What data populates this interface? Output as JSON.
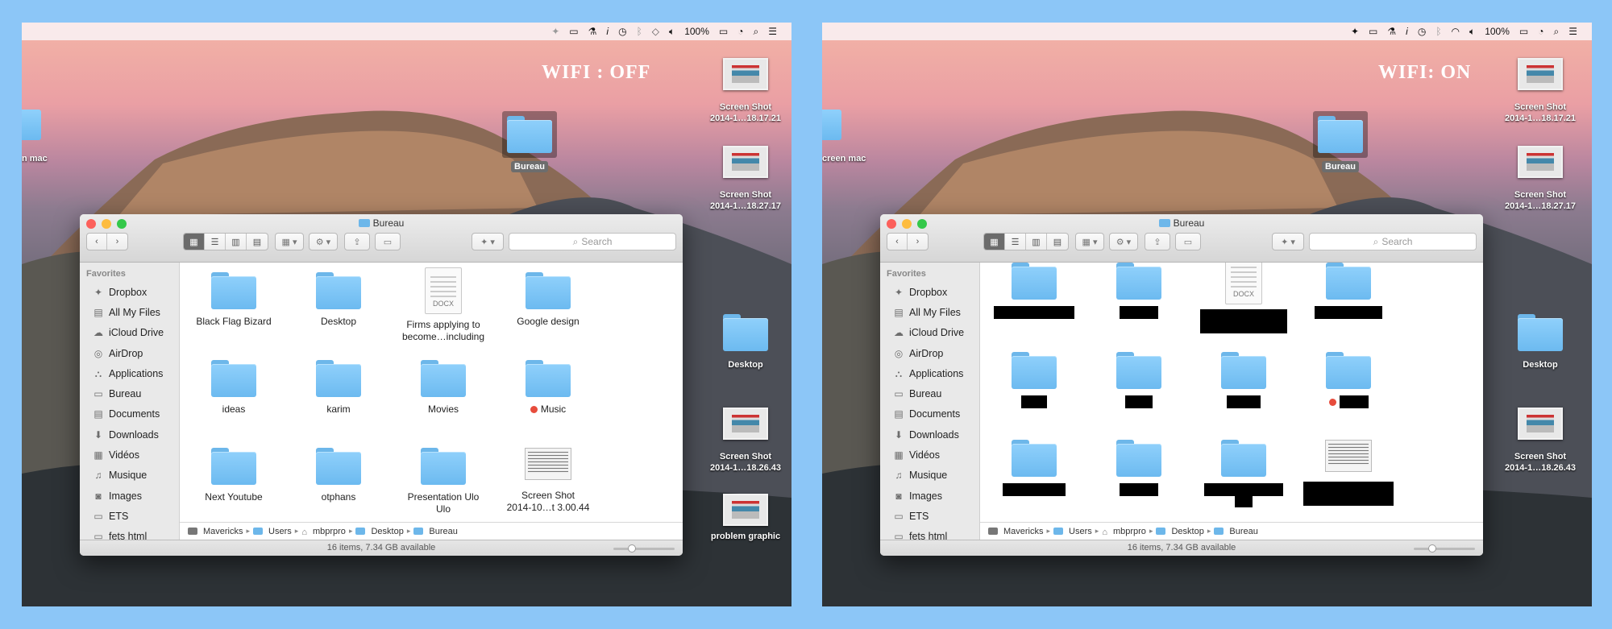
{
  "menubar": {
    "battery": "100%"
  },
  "left": {
    "caption": "WIFI : OFF",
    "edge_label": "n mac",
    "desktop": {
      "bureau": "Bureau",
      "shot1": [
        "Screen Shot",
        "2014-1…18.17.21"
      ],
      "shot2": [
        "Screen Shot",
        "2014-1…18.27.17"
      ],
      "desktop_folder": "Desktop",
      "shot3": [
        "Screen Shot",
        "2014-1…18.26.43"
      ],
      "problem": "problem graphic"
    }
  },
  "right": {
    "caption": "WIFI: ON",
    "edge_label": "creen mac",
    "desktop": {
      "bureau": "Bureau",
      "shot1": [
        "Screen Shot",
        "2014-1…18.17.21"
      ],
      "shot2": [
        "Screen Shot",
        "2014-1…18.27.17"
      ],
      "desktop_folder": "Desktop",
      "shot3": [
        "Screen Shot",
        "2014-1…18.26.43"
      ]
    }
  },
  "finder": {
    "title": "Bureau",
    "search_placeholder": "Search",
    "sidebar_heading": "Favorites",
    "sidebar_items": [
      {
        "label": "Dropbox",
        "icon": "dropbox-icon"
      },
      {
        "label": "All My Files",
        "icon": "all-files-icon"
      },
      {
        "label": "iCloud Drive",
        "icon": "cloud-icon"
      },
      {
        "label": "AirDrop",
        "icon": "airdrop-icon"
      },
      {
        "label": "Applications",
        "icon": "applications-icon"
      },
      {
        "label": "Bureau",
        "icon": "folder-icon"
      },
      {
        "label": "Documents",
        "icon": "documents-icon"
      },
      {
        "label": "Downloads",
        "icon": "downloads-icon"
      },
      {
        "label": "Vidéos",
        "icon": "video-icon"
      },
      {
        "label": "Musique",
        "icon": "music-icon"
      },
      {
        "label": "Images",
        "icon": "camera-icon"
      },
      {
        "label": "ETS",
        "icon": "folder-icon"
      },
      {
        "label": "fets html",
        "icon": "folder-icon"
      }
    ],
    "items": [
      {
        "name": "Black Flag Bizard",
        "line2": "",
        "kind": "folder"
      },
      {
        "name": "Desktop",
        "line2": "",
        "kind": "folder"
      },
      {
        "name": "Firms applying to",
        "line2": "become…including",
        "kind": "docx"
      },
      {
        "name": "Google design",
        "line2": "",
        "kind": "folder"
      },
      {
        "name": "ideas",
        "line2": "",
        "kind": "folder"
      },
      {
        "name": "karim",
        "line2": "",
        "kind": "folder"
      },
      {
        "name": "Movies",
        "line2": "",
        "kind": "folder"
      },
      {
        "name": "Music",
        "line2": "",
        "kind": "folder",
        "tag": "red"
      },
      {
        "name": "Next Youtube",
        "line2": "",
        "kind": "folder"
      },
      {
        "name": "otphans",
        "line2": "",
        "kind": "folder"
      },
      {
        "name": "Presentation Ulo",
        "line2": "Ulo",
        "kind": "folder"
      },
      {
        "name": "Screen Shot",
        "line2": "2014-10…t 3.00.44",
        "kind": "screenshot"
      }
    ],
    "docx_label": "DOCX",
    "path": [
      "Mavericks",
      "Users",
      "mbprpro",
      "Desktop",
      "Bureau"
    ],
    "status": "16 items, 7.34 GB available",
    "colors": {
      "folder": "#6cbaf0",
      "selected_view": "#6b6b6b",
      "tag_red": "#e74c3c"
    }
  }
}
